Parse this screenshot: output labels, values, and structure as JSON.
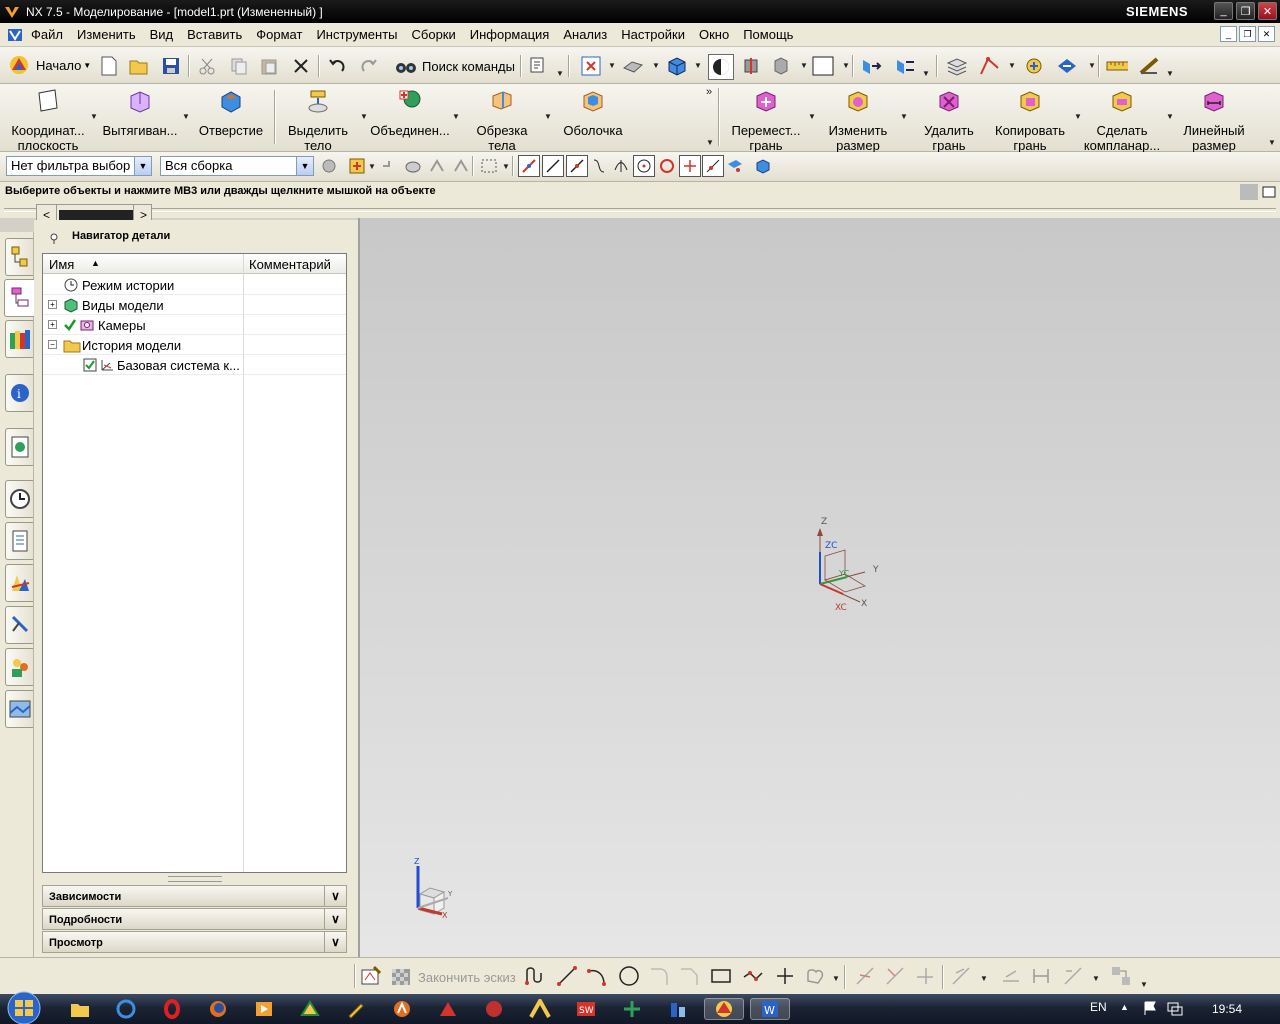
{
  "window": {
    "title": "NX 7.5 - Моделирование - [model1.prt (Измененный) ]",
    "brand": "SIEMENS",
    "controls": [
      "minimize",
      "maximize",
      "close"
    ]
  },
  "menu": [
    {
      "label": "Файл"
    },
    {
      "label": "Изменить"
    },
    {
      "label": "Вид"
    },
    {
      "label": "Вставить"
    },
    {
      "label": "Формат"
    },
    {
      "label": "Инструменты"
    },
    {
      "label": "Сборки"
    },
    {
      "label": "Информация"
    },
    {
      "label": "Анализ"
    },
    {
      "label": "Настройки"
    },
    {
      "label": "Окно"
    },
    {
      "label": "Помощь"
    }
  ],
  "standard_toolbar": {
    "start_label": "Начало",
    "command_finder_label": "Поиск команды"
  },
  "feature_toolbar": [
    {
      "label1": "Координат...",
      "label2": "плоскость",
      "icon": "datum-plane-icon"
    },
    {
      "label1": "Вытягиван...",
      "label2": "",
      "icon": "extrude-icon"
    },
    {
      "label1": "Отверстие",
      "label2": "",
      "icon": "hole-icon"
    },
    {
      "label1": "Выделить",
      "label2": "тело",
      "icon": "extract-body-icon"
    },
    {
      "label1": "Объединен...",
      "label2": "",
      "icon": "unite-icon"
    },
    {
      "label1": "Обрезка",
      "label2": "тела",
      "icon": "trim-body-icon"
    },
    {
      "label1": "Оболочка",
      "label2": "",
      "icon": "shell-icon"
    }
  ],
  "sync_toolbar": [
    {
      "label1": "Перемест...",
      "label2": "грань",
      "icon": "move-face-icon"
    },
    {
      "label1": "Изменить",
      "label2": "размер",
      "icon": "resize-icon"
    },
    {
      "label1": "Удалить",
      "label2": "грань",
      "icon": "delete-face-icon"
    },
    {
      "label1": "Копировать",
      "label2": "грань",
      "icon": "copy-face-icon"
    },
    {
      "label1": "Сделать",
      "label2": "компланар...",
      "icon": "make-coplanar-icon"
    },
    {
      "label1": "Линейный",
      "label2": "размер",
      "icon": "linear-dimension-icon"
    }
  ],
  "selection_bar": {
    "filter_value": "Нет фильтра выбор",
    "scope_value": "Вся сборка"
  },
  "cue_line": "Выберите объекты и нажмите MB3 или дважды щелкните мышкой на объекте",
  "navigator": {
    "title": "Навигатор детали",
    "col_name": "Имя",
    "col_comment": "Комментарий",
    "rows": [
      {
        "label": "Режим истории",
        "icon": "clock-icon"
      },
      {
        "label": "Виды модели",
        "icon": "model-views-icon"
      },
      {
        "label": "Камеры",
        "icon": "cameras-icon"
      },
      {
        "label": "История модели",
        "icon": "folder-icon"
      },
      {
        "label": "Базовая система к...",
        "icon": "datum-csys-icon"
      }
    ],
    "sections": [
      "Зависимости",
      "Подробности",
      "Просмотр"
    ]
  },
  "triad": {
    "z": "Z",
    "zc": "ZC",
    "y": "Y",
    "yc": "YC",
    "x": "X",
    "xc": "XC"
  },
  "view_triad": {
    "z": "Z",
    "y": "Y",
    "x": "X"
  },
  "sketch_bar": {
    "finish_label": "Закончить эскиз"
  },
  "taskbar": {
    "lang": "EN",
    "time": "19:54"
  },
  "colors": {
    "title_bg": "#000000",
    "menu_bg": "#ece9d8",
    "graphics_top": "#c8c8c8",
    "graphics_bottom": "#e6e6e6",
    "axis_x": "#c0392b",
    "axis_y": "#2e9a3e",
    "axis_z": "#1f4fd1"
  }
}
